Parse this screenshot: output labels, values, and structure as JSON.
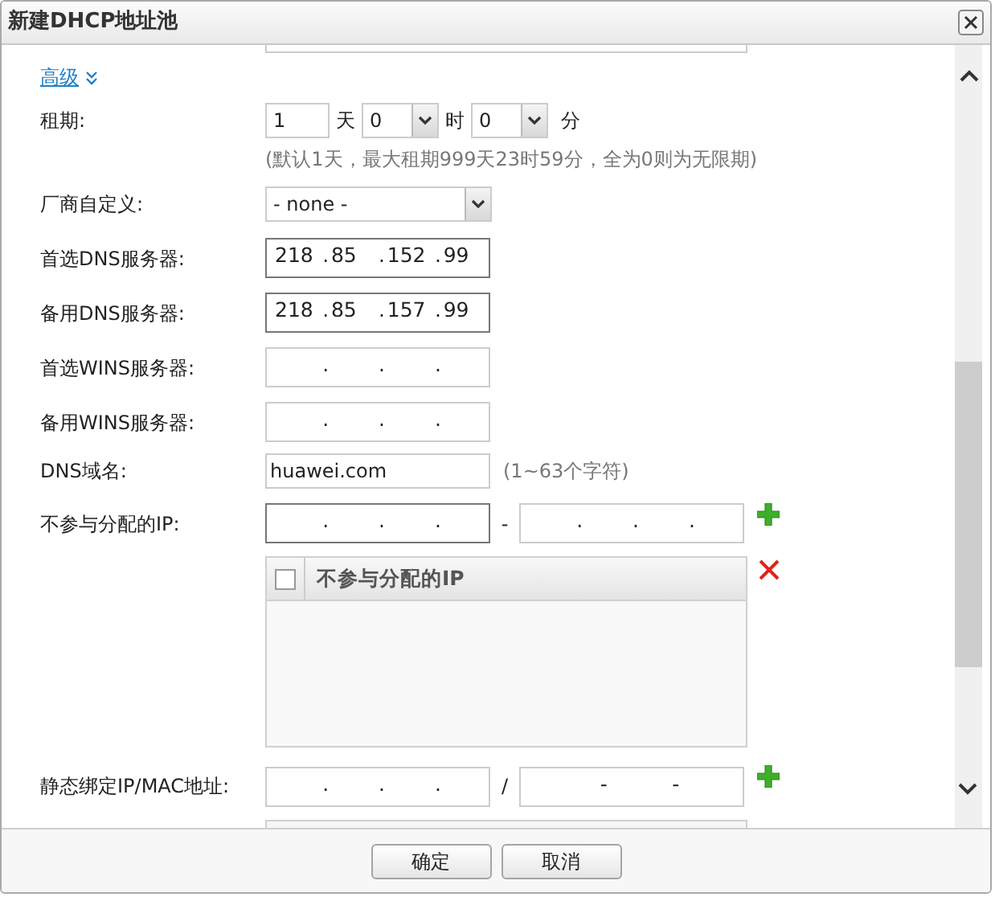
{
  "dialog": {
    "title": "新建DHCP地址池"
  },
  "advanced": {
    "label": "高级"
  },
  "lease": {
    "label": "租期:",
    "days": "1",
    "days_unit": "天",
    "hours": "0",
    "hours_unit": "时",
    "minutes": "0",
    "minutes_unit": "分",
    "hint": "(默认1天，最大租期999天23时59分，全为0则为无限期)"
  },
  "vendor": {
    "label": "厂商自定义:",
    "value": "- none -"
  },
  "servers": [
    {
      "label": "首选DNS服务器:",
      "kind": "ip",
      "separator": ".",
      "focused": true,
      "octets": [
        "218",
        "85",
        "152",
        "99"
      ]
    },
    {
      "label": "备用DNS服务器:",
      "kind": "ip",
      "separator": ".",
      "focused": true,
      "octets": [
        "218",
        "85",
        "157",
        "99"
      ]
    },
    {
      "label": "首选WINS服务器:",
      "kind": "ip",
      "separator": ".",
      "focused": false
    },
    {
      "label": "备用WINS服务器:",
      "kind": "ip",
      "separator": ".",
      "focused": false
    }
  ],
  "domain": {
    "label": "DNS域名:",
    "value": "huawei.com",
    "hint": "(1~63个字符)"
  },
  "exclude": {
    "label": "不参与分配的IP:",
    "start": {
      "kind": "ip",
      "separator": ".",
      "focused": true
    },
    "range_separator": "-",
    "end": {
      "kind": "ip",
      "separator": ".",
      "focused": false
    }
  },
  "exclude_table": {
    "header": "不参与分配的IP",
    "select_all_checked": false
  },
  "static_binding": {
    "label": "静态绑定IP/MAC地址:",
    "ip": {
      "kind": "ip",
      "separator": ".",
      "focused": false
    },
    "joiner": "/",
    "mac": {
      "kind": "mac",
      "separator": "-",
      "focused": false
    }
  },
  "buttons": [
    "确定",
    "取消"
  ]
}
